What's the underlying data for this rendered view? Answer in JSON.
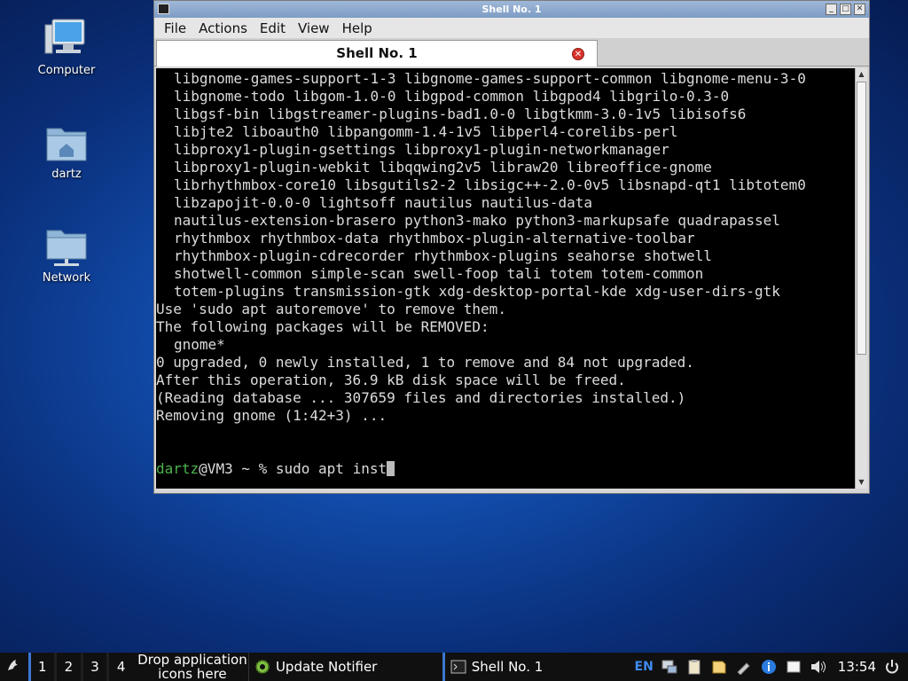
{
  "desktop": {
    "icons": [
      {
        "label": "Computer"
      },
      {
        "label": "dartz"
      },
      {
        "label": "Network"
      }
    ]
  },
  "window": {
    "title": "Shell No. 1",
    "menu": [
      "File",
      "Actions",
      "Edit",
      "View",
      "Help"
    ],
    "tab_label": "Shell No. 1"
  },
  "terminal": {
    "lines": [
      {
        "text": "libgnome-games-support-1-3 libgnome-games-support-common libgnome-menu-3-0",
        "indent": true
      },
      {
        "text": "libgnome-todo libgom-1.0-0 libgpod-common libgpod4 libgrilo-0.3-0",
        "indent": true
      },
      {
        "text": "libgsf-bin libgstreamer-plugins-bad1.0-0 libgtkmm-3.0-1v5 libisofs6",
        "indent": true
      },
      {
        "text": "libjte2 liboauth0 libpangomm-1.4-1v5 libperl4-corelibs-perl",
        "indent": true
      },
      {
        "text": "libproxy1-plugin-gsettings libproxy1-plugin-networkmanager",
        "indent": true
      },
      {
        "text": "libproxy1-plugin-webkit libqqwing2v5 libraw20 libreoffice-gnome",
        "indent": true
      },
      {
        "text": "librhythmbox-core10 libsgutils2-2 libsigc++-2.0-0v5 libsnapd-qt1 libtotem0",
        "indent": true
      },
      {
        "text": "libzapojit-0.0-0 lightsoff nautilus nautilus-data",
        "indent": true
      },
      {
        "text": "nautilus-extension-brasero python3-mako python3-markupsafe quadrapassel",
        "indent": true
      },
      {
        "text": "rhythmbox rhythmbox-data rhythmbox-plugin-alternative-toolbar",
        "indent": true
      },
      {
        "text": "rhythmbox-plugin-cdrecorder rhythmbox-plugins seahorse shotwell",
        "indent": true
      },
      {
        "text": "shotwell-common simple-scan swell-foop tali totem totem-common",
        "indent": true
      },
      {
        "text": "totem-plugins transmission-gtk xdg-desktop-portal-kde xdg-user-dirs-gtk",
        "indent": true
      },
      {
        "text": "Use 'sudo apt autoremove' to remove them.",
        "indent": false
      },
      {
        "text": "The following packages will be REMOVED:",
        "indent": false
      },
      {
        "text": "gnome*",
        "indent": true
      },
      {
        "text": "0 upgraded, 0 newly installed, 1 to remove and 84 not upgraded.",
        "indent": false
      },
      {
        "text": "After this operation, 36.9 kB disk space will be freed.",
        "indent": false
      },
      {
        "text": "(Reading database ... 307659 files and directories installed.)",
        "indent": false
      },
      {
        "text": "Removing gnome (1:42+3) ...",
        "indent": false
      },
      {
        "text": "",
        "indent": false
      },
      {
        "text": "",
        "indent": false
      }
    ],
    "prompt_user": "dartz",
    "prompt_rest": "@VM3 ~ % ",
    "command": "sudo apt inst"
  },
  "taskbar": {
    "workspaces": [
      "1",
      "2",
      "3",
      "4"
    ],
    "launcher_text": "Drop application icons here",
    "tasks": [
      {
        "label": "Update Notifier",
        "icon": "gear-icon"
      },
      {
        "label": "Shell No. 1",
        "icon": "terminal-icon"
      }
    ],
    "keyboard_layout": "EN",
    "clock": "13:54"
  }
}
